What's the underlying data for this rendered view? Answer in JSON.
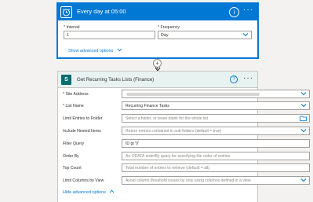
{
  "recurrence": {
    "title": "Every day at 05:00",
    "interval_label": "* Interval",
    "interval_value": "1",
    "frequency_label": "* Frequency",
    "frequency_value": "Day",
    "advanced_link": "Show advanced options",
    "accent_color": "#0078d4"
  },
  "connector": {
    "plus_glyph": "+"
  },
  "get_items": {
    "title": "Get Recurring Tasks Lists (Finance)",
    "icon_letter": "S",
    "accent_color": "#036c70",
    "fields": [
      {
        "label": "* Site Address",
        "value": "",
        "placeholder": "",
        "blurred": true,
        "dropdown": true
      },
      {
        "label": "* List Name",
        "value": "Recurring Finance Tasks",
        "placeholder": "",
        "dropdown": true
      },
      {
        "label": "Limit Entries to Folder",
        "value": "",
        "placeholder": "Select a folder, or leave blank for the whole list",
        "folder_icon": true
      },
      {
        "label": "Include Nested Items",
        "value": "",
        "placeholder": "Return entries contained in sub-folders (default = true)",
        "dropdown": true
      },
      {
        "label": "Filter Query",
        "value": "ID gt '0'",
        "placeholder": ""
      },
      {
        "label": "Order By",
        "value": "",
        "placeholder": "An ODATA orderBy query for specifying the order of entries."
      },
      {
        "label": "Top Count",
        "value": "",
        "placeholder": "Total number of entries to retrieve (default = all)."
      },
      {
        "label": "Limit Columns by View",
        "value": "",
        "placeholder": "Avoid column threshold issues by only using columns defined in a view",
        "dropdown": true
      }
    ],
    "advanced_link": "Hide advanced options"
  }
}
